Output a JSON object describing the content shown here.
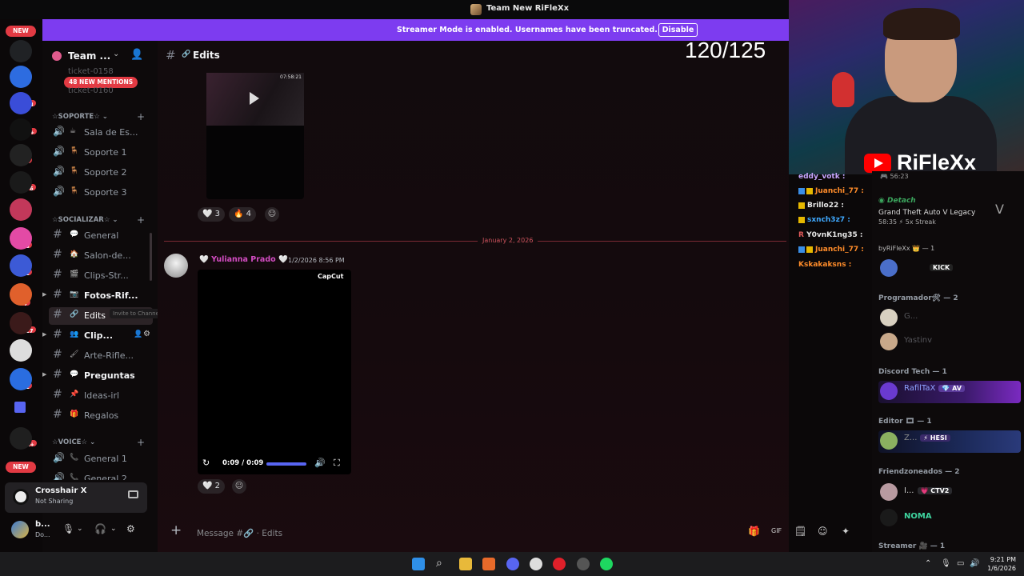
{
  "window": {
    "title": "Team New RiFleXx"
  },
  "banner": {
    "message": "Streamer Mode is enabled. Usernames have been truncated.",
    "button": "Disable"
  },
  "rail": {
    "new_top": "NEW",
    "new_bottom": "NEW",
    "badges": [
      "13",
      "278",
      "1K+",
      "81",
      "436",
      "48",
      "31",
      "4",
      "117",
      "1",
      "41",
      "1K+"
    ]
  },
  "sidebar": {
    "guild_name": "Team ...",
    "mentions_pill": "48 NEW MENTIONS",
    "faded_top": "ticket-0158",
    "faded_2": "ticket-0160",
    "cat_soporte": "☆SOPORTE☆",
    "cat_socializar": "☆SOCIALIZAR☆",
    "cat_voice": "☆VOICE☆",
    "voice_soporte": [
      "Sala de Es...",
      "Soporte 1",
      "Soporte 2",
      "Soporte 3"
    ],
    "channels": [
      {
        "label": "General",
        "emoji": "💬"
      },
      {
        "label": "Salon-de...",
        "emoji": "🏠"
      },
      {
        "label": "Clips-Str...",
        "emoji": "🎬"
      },
      {
        "label": "Fotos-Rif...",
        "emoji": "📷"
      },
      {
        "label": "Edits",
        "emoji": "🔗"
      },
      {
        "label": "Clip...",
        "emoji": "👥"
      },
      {
        "label": "Arte-Rifle...",
        "emoji": "🖌"
      },
      {
        "label": "Preguntas",
        "emoji": "💬"
      },
      {
        "label": "Ideas-irl",
        "emoji": "📌"
      },
      {
        "label": "Regalos",
        "emoji": "🎁"
      }
    ],
    "tooltip": "Invite to Channel",
    "voice_general1": "General 1",
    "voice_general2": "General 2"
  },
  "activity_panel": {
    "name": "Crosshair X",
    "status": "Not Sharing"
  },
  "user_panel": {
    "name": "b...",
    "status": "Do..."
  },
  "channel": {
    "name": "Edits",
    "counter": "120/125"
  },
  "messages": {
    "video1_timestamp": "07:58:21",
    "reactions1": [
      {
        "emoji": "🤍",
        "count": "3"
      },
      {
        "emoji": "🔥",
        "count": "4"
      }
    ],
    "divider_date": "January 2, 2026",
    "author": "Yulianna Prado",
    "time": "1/2/2026 8:56 PM",
    "video2_watermark": "CapCut",
    "video2_time": "0:09 / 0:09",
    "reactions2": [
      {
        "emoji": "🤍",
        "count": "2"
      }
    ]
  },
  "composer": {
    "placeholder": "Message #🔗 · Edits"
  },
  "webcam": {
    "brand": "RiFleXx"
  },
  "stream_chat": [
    {
      "name": "eddy_votk :",
      "color": "#c7a6ff"
    },
    {
      "name": "Juanchi_77 :",
      "color": "#ff8c2a"
    },
    {
      "name": "Brillo22 :",
      "color": "#e8e8e8"
    },
    {
      "name": "sxnch3z7 :",
      "color": "#3fa9ff"
    },
    {
      "name": "Y0vnK1ng35 :",
      "color": "#e8e8e8"
    },
    {
      "name": "Juanchi_77 :",
      "color": "#ff8c2a"
    },
    {
      "name": "Kskakaksns :",
      "color": "#ff8c2a"
    }
  ],
  "members": {
    "top_time": "56:23",
    "activity_user": "Detach",
    "activity_game": "Grand Theft Auto V Legacy",
    "activity_meta": "58:35 ⚡ 5x Streak",
    "by_line": "byRiFleXx 👑 — 1",
    "kick_tag": "KICK",
    "group_programador": "Programador🛠 — 2",
    "prog_user1": "G...",
    "prog_user2": "Yastinv",
    "group_discordtech": "Discord Tech — 1",
    "tech_user": "RafilTaX",
    "tech_tag": "AV",
    "group_editor": "Editor 🎞 — 1",
    "editor_user": "Z...",
    "editor_tag": "HESI",
    "group_friendzone": "Friendzoneados — 2",
    "fz_user1": "I...",
    "fz_tag": "CTV2",
    "fz_user2": "NOMA",
    "group_streamer": "Streamer 🎥 — 1"
  },
  "clock": {
    "time": "9:21 PM",
    "date": "1/6/2026"
  }
}
